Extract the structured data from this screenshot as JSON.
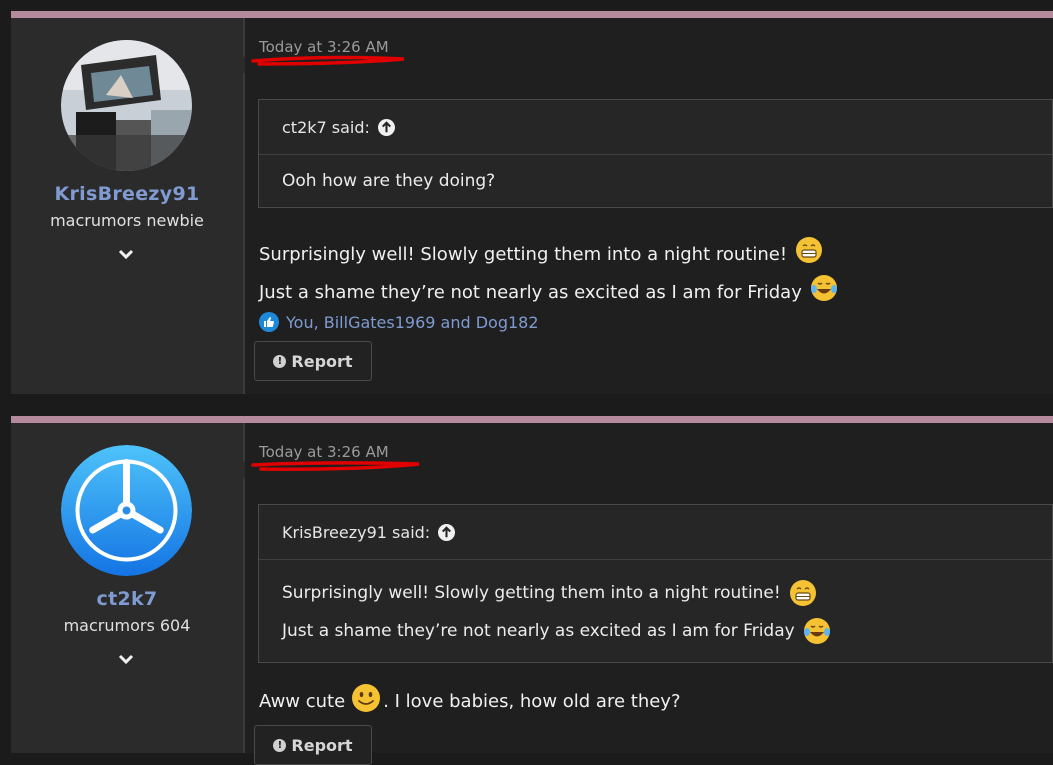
{
  "posts": [
    {
      "author": "KrisBreezy91",
      "user_title": "macrumors newbie",
      "timestamp": "Today at 3:26 AM",
      "quote": {
        "author_said": "ct2k7 said:",
        "lines": [
          "Ooh how are they doing?"
        ]
      },
      "body_lines": [
        "Surprisingly well! Slowly getting them into a night routine!",
        "Just a shame they’re not nearly as excited as I am for Friday"
      ],
      "reactions_text": "You, BillGates1969 and Dog182",
      "report_label": "Report"
    },
    {
      "author": "ct2k7",
      "user_title": "macrumors 604",
      "timestamp": "Today at 3:26 AM",
      "quote": {
        "author_said": "KrisBreezy91 said:",
        "lines": [
          "Surprisingly well! Slowly getting them into a night routine!",
          "Just a shame they’re not nearly as excited as I am for Friday"
        ]
      },
      "body_part1": "Aww cute",
      "body_part2": ". I love babies, how old are they?",
      "report_label": "Report"
    }
  ],
  "colors": {
    "accent_bar": "#b58a9c",
    "username": "#7f9bd1",
    "annotation": "#e00000"
  }
}
